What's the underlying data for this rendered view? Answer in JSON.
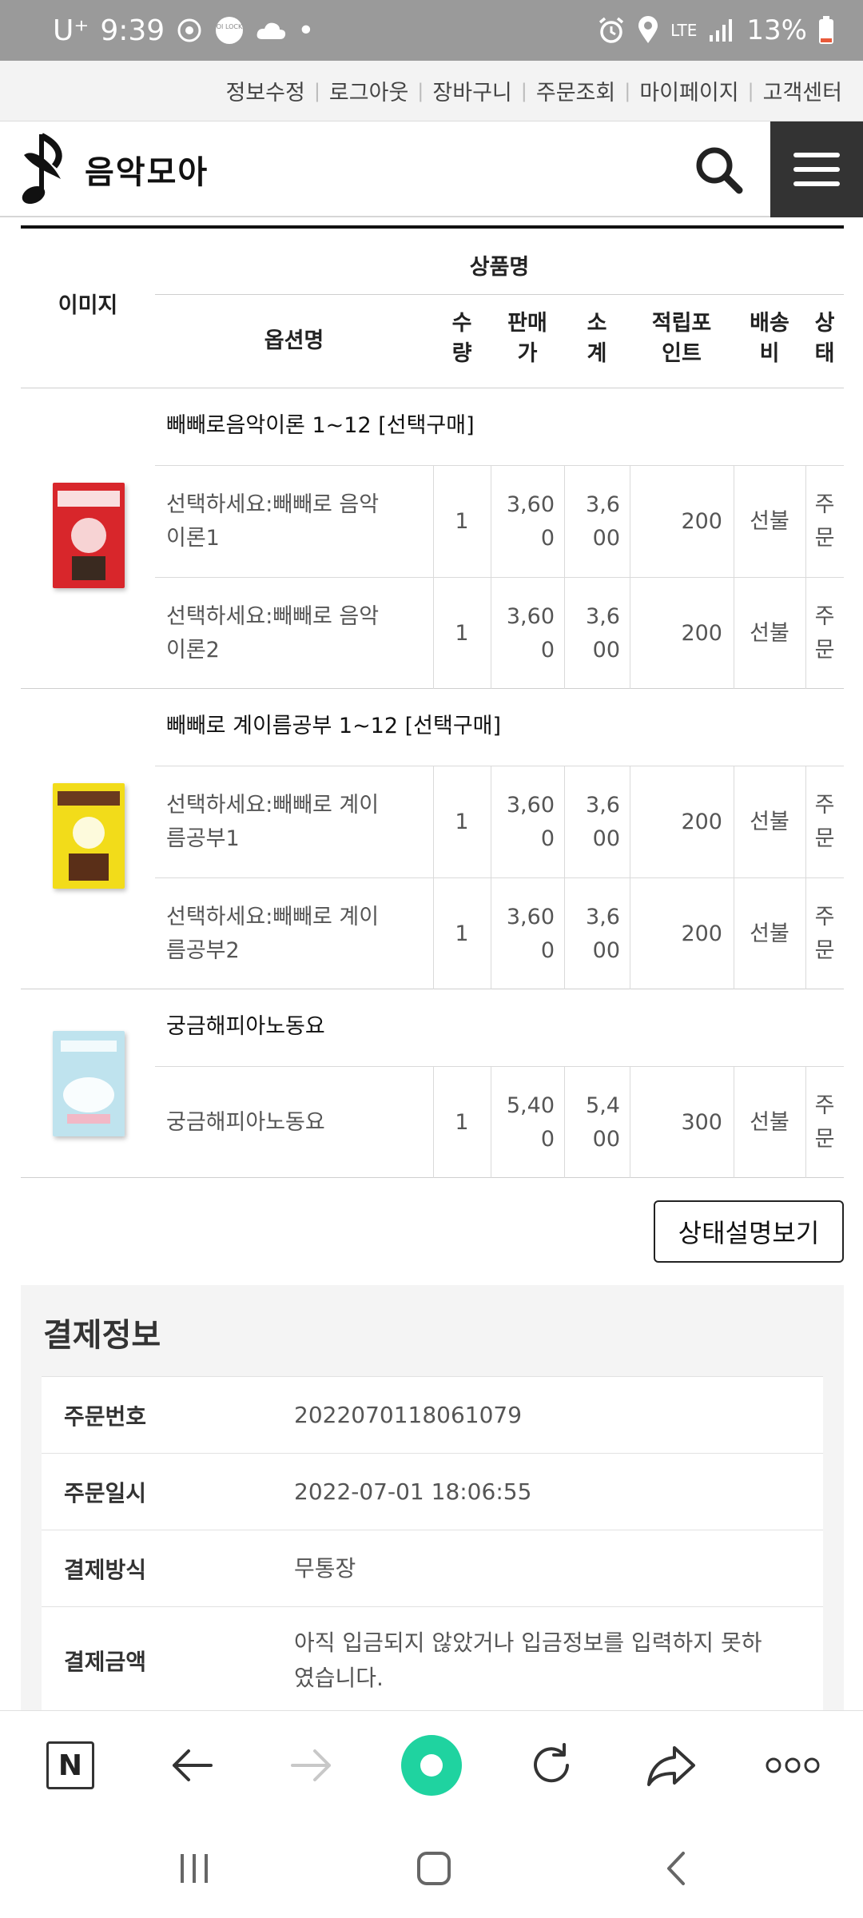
{
  "status_bar": {
    "carrier": "U⁺",
    "time": "9:39",
    "lock_badge": "OI LOCK",
    "dot": "•",
    "network": "LTE",
    "battery": "13%"
  },
  "top_links": [
    "정보수정",
    "로그아웃",
    "장바구니",
    "주문조회",
    "마이페이지",
    "고객센터"
  ],
  "header": {
    "logo_text": "음악모아"
  },
  "table": {
    "headers": {
      "image": "이미지",
      "product_name": "상품명",
      "option_name": "옵션명",
      "qty": "수\n량",
      "price": "판매\n가",
      "subtotal": "소\n계",
      "points": "적립포\n인트",
      "shipping": "배송\n비",
      "status": "상\n태"
    },
    "groups": [
      {
        "title": "빼빼로음악이론 1~12 [선택구매]",
        "cover_color": "#d8262b",
        "rows": [
          {
            "option": "선택하세요:빼빼로 음악\n이론1",
            "qty": "1",
            "price": "3,60\n0",
            "subtotal": "3,6\n00",
            "points": "200",
            "shipping": "선불",
            "status": "주\n문"
          },
          {
            "option": "선택하세요:빼빼로 음악\n이론2",
            "qty": "1",
            "price": "3,60\n0",
            "subtotal": "3,6\n00",
            "points": "200",
            "shipping": "선불",
            "status": "주\n문"
          }
        ]
      },
      {
        "title": "빼빼로 계이름공부 1~12 [선택구매]",
        "cover_color": "#f2dc1a",
        "rows": [
          {
            "option": "선택하세요:빼빼로 계이\n름공부1",
            "qty": "1",
            "price": "3,60\n0",
            "subtotal": "3,6\n00",
            "points": "200",
            "shipping": "선불",
            "status": "주\n문"
          },
          {
            "option": "선택하세요:빼빼로 계이\n름공부2",
            "qty": "1",
            "price": "3,60\n0",
            "subtotal": "3,6\n00",
            "points": "200",
            "shipping": "선불",
            "status": "주\n문"
          }
        ]
      },
      {
        "title": "궁금해피아노동요",
        "cover_color": "#bfe3ee",
        "rows": [
          {
            "option": "궁금해피아노동요",
            "qty": "1",
            "price": "5,40\n0",
            "subtotal": "5,4\n00",
            "points": "300",
            "shipping": "선불",
            "status": "주\n문"
          }
        ]
      }
    ]
  },
  "status_button": "상태설명보기",
  "payment": {
    "title": "결제정보",
    "rows": [
      {
        "label": "주문번호",
        "value": "2022070118061079"
      },
      {
        "label": "주문일시",
        "value": "2022-07-01 18:06:55"
      },
      {
        "label": "결제방식",
        "value": "무통장"
      },
      {
        "label": "결제금액",
        "value": "아직 입금되지 않았거나 입금정보를 입력하지 못하\n였습니다."
      }
    ]
  },
  "browser": {
    "n_label": "N"
  }
}
